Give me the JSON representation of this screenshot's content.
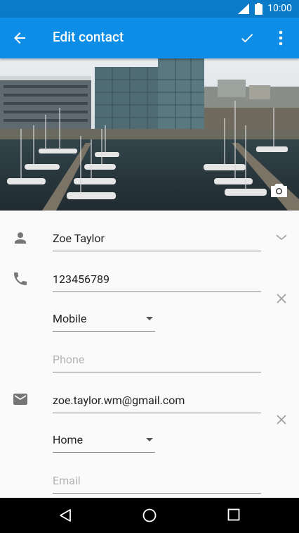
{
  "status": {
    "time": "10:00"
  },
  "header": {
    "title": "Edit contact"
  },
  "contact": {
    "name": "Zoe Taylor",
    "phone": {
      "value": "123456789",
      "type": "Mobile",
      "new_placeholder": "Phone"
    },
    "email": {
      "value": "zoe.taylor.wm@gmail.com",
      "type": "Home",
      "new_placeholder": "Email"
    }
  },
  "icons": {
    "back": "arrow-back-icon",
    "save": "check-icon",
    "more": "more-vert-icon",
    "camera": "camera-icon",
    "person": "person-icon",
    "phone": "phone-icon",
    "email": "email-icon"
  },
  "colors": {
    "status_bar": "#0a7bc9",
    "app_bar": "#0e8de6",
    "background": "#fafafa"
  }
}
